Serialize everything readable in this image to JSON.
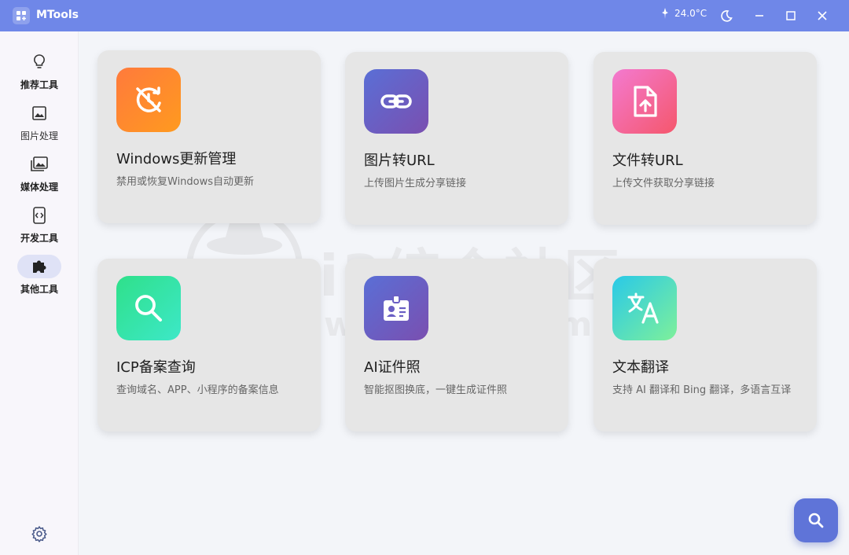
{
  "titlebar": {
    "title": "MTools",
    "weather": "24.0°C"
  },
  "sidebar": {
    "items": [
      {
        "label": "推荐工具",
        "icon": "lightbulb-icon"
      },
      {
        "label": "图片处理",
        "icon": "image-icon"
      },
      {
        "label": "媒体处理",
        "icon": "media-library-icon"
      },
      {
        "label": "开发工具",
        "icon": "dev-code-icon"
      },
      {
        "label": "其他工具",
        "icon": "puzzle-icon",
        "active": true
      }
    ],
    "settings_icon": "gear-icon"
  },
  "cards": [
    {
      "title": "Windows更新管理",
      "desc": "禁用或恢复Windows自动更新",
      "icon": "update-off-icon",
      "colors": [
        "#ff7a3c",
        "#ff9a1f"
      ]
    },
    {
      "title": "图片转URL",
      "desc": "上传图片生成分享链接",
      "icon": "link-icon",
      "colors": [
        "#5a6fd6",
        "#7a4fb0"
      ]
    },
    {
      "title": "文件转URL",
      "desc": "上传文件获取分享链接",
      "icon": "file-upload-icon",
      "colors": [
        "#f37ad0",
        "#f5576c"
      ]
    },
    {
      "title": "ICP备案查询",
      "desc": "查询域名、APP、小程序的备案信息",
      "icon": "search-icon",
      "colors": [
        "#2fe08a",
        "#3de8c8"
      ]
    },
    {
      "title": "AI证件照",
      "desc": "智能抠图换底，一键生成证件照",
      "icon": "id-badge-icon",
      "colors": [
        "#5a6fd6",
        "#7a4fb0"
      ]
    },
    {
      "title": "文本翻译",
      "desc": "支持 AI 翻译和 Bing 翻译，多语言互译",
      "icon": "translate-icon",
      "colors": [
        "#29c9e8",
        "#7ef09a"
      ]
    }
  ],
  "watermark": {
    "text": "i3综合社区",
    "url": "www.i3zh.com"
  },
  "fab": {
    "icon": "search-icon"
  }
}
